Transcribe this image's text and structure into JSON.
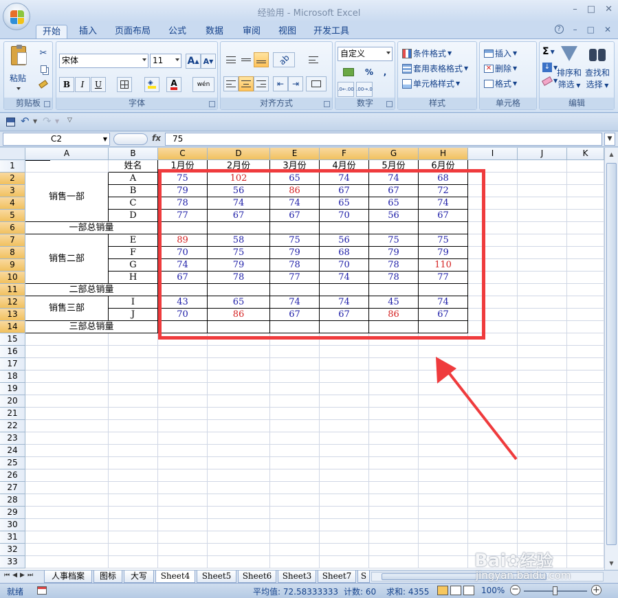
{
  "window": {
    "title": "经验用 - Microsoft Excel",
    "controls": [
      "–",
      "□",
      "✕"
    ]
  },
  "tabs": [
    "开始",
    "插入",
    "页面布局",
    "公式",
    "数据",
    "审阅",
    "视图",
    "开发工具"
  ],
  "tab_right": [
    "?",
    "–",
    "□",
    "✕"
  ],
  "ribbon": {
    "clipboard": {
      "label": "剪贴板",
      "paste": "粘贴"
    },
    "font": {
      "label": "字体",
      "name": "宋体",
      "size": "11",
      "grow": "A",
      "shrink": "A",
      "bold": "B",
      "italic": "I",
      "underline": "U",
      "phonetic": "wén"
    },
    "align": {
      "label": "对齐方式"
    },
    "number": {
      "label": "数字",
      "format": "自定义",
      "percent": "%",
      "comma": ",",
      "inc": ".0←.00",
      "dec": ".00→.0"
    },
    "styles": {
      "label": "样式",
      "cond": "条件格式",
      "table": "套用表格格式",
      "cell": "单元格样式"
    },
    "cells": {
      "label": "单元格",
      "insert": "插入",
      "delete": "删除",
      "format": "格式"
    },
    "editing": {
      "label": "编辑",
      "sort": "排序和",
      "sort2": "筛选",
      "find": "查找和",
      "find2": "选择"
    }
  },
  "formula_bar": {
    "name_box": "C2",
    "fx": "fx",
    "value": "75"
  },
  "columns": [
    "A",
    "B",
    "C",
    "D",
    "E",
    "F",
    "G",
    "H",
    "I",
    "J",
    "K"
  ],
  "rows": [
    "1",
    "2",
    "3",
    "4",
    "5",
    "6",
    "7",
    "8",
    "9",
    "10",
    "11",
    "12",
    "13",
    "14",
    "15",
    "16",
    "17",
    "18",
    "19",
    "20",
    "21",
    "22",
    "23",
    "24",
    "25",
    "26",
    "27",
    "28",
    "29",
    "30",
    "31",
    "32",
    "33"
  ],
  "header_row": [
    "姓名",
    "1月份",
    "2月份",
    "3月份",
    "4月份",
    "5月份",
    "6月份"
  ],
  "groups": [
    {
      "name": "销售一部",
      "total": "一部总销量"
    },
    {
      "name": "销售二部",
      "total": "二部总销量"
    },
    {
      "name": "销售三部",
      "total": "三部总销量"
    }
  ],
  "data_rows": [
    {
      "name": "A",
      "values": [
        75,
        102,
        65,
        74,
        74,
        68
      ]
    },
    {
      "name": "B",
      "values": [
        79,
        56,
        86,
        67,
        67,
        72
      ]
    },
    {
      "name": "C",
      "values": [
        78,
        74,
        74,
        65,
        65,
        74
      ]
    },
    {
      "name": "D",
      "values": [
        77,
        67,
        67,
        70,
        56,
        67
      ]
    },
    {
      "name": "E",
      "values": [
        89,
        58,
        75,
        56,
        75,
        75
      ]
    },
    {
      "name": "F",
      "values": [
        70,
        75,
        79,
        68,
        79,
        79
      ]
    },
    {
      "name": "G",
      "values": [
        74,
        79,
        78,
        70,
        78,
        110
      ]
    },
    {
      "name": "H",
      "values": [
        67,
        78,
        77,
        74,
        78,
        77
      ]
    },
    {
      "name": "I",
      "values": [
        43,
        65,
        74,
        74,
        45,
        74
      ]
    },
    {
      "name": "J",
      "values": [
        70,
        86,
        67,
        67,
        86,
        67
      ]
    }
  ],
  "colors": {
    "normal_value": "#1a1aa6",
    "high_value": "#d42020",
    "highlight_box": "#ef3b3d",
    "arrow": "#ef3b3d"
  },
  "sheet_tabs": [
    "人事档案",
    "图标",
    "大写",
    "Sheet4",
    "Sheet5",
    "Sheet6",
    "Sheet3",
    "Sheet7",
    "S"
  ],
  "active_sheet": "Sheet4",
  "status": {
    "ready": "就绪",
    "average": "平均值: 72.58333333",
    "count": "计数: 60",
    "sum": "求和: 4355",
    "zoom": "100%"
  },
  "watermark": {
    "brand": "Bai",
    "brand2": "经验",
    "url": "jingyan.baidu.com"
  }
}
